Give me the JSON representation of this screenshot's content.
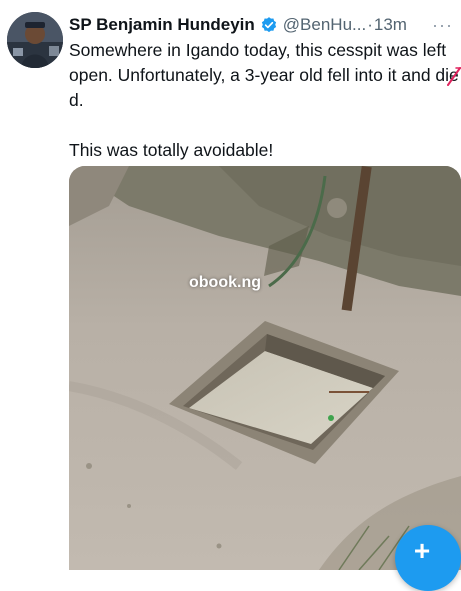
{
  "tweet": {
    "author_name": "SP Benjamin Hundeyin",
    "handle": "@BenHu...",
    "separator": "·",
    "timestamp": "13m",
    "more_label": "···",
    "text_line_1": "Somewhere in Igando today, this cesspit was left open. Unfortunately, a 3-year old fell into it and di",
    "struck_letter": "e",
    "text_line_1_end": "d.",
    "text_line_2": "This was totally avoidable!",
    "media": {
      "watermark": "obook.ng"
    }
  },
  "fab": {
    "label": "+"
  },
  "colors": {
    "accent": "#1d9bf0",
    "text": "#0f1419",
    "secondary_text": "#536471",
    "strike": "#e0245e"
  },
  "icons": {
    "verified": "verified-badge-icon",
    "more": "more-horizontal-icon",
    "compose": "plus-icon"
  }
}
